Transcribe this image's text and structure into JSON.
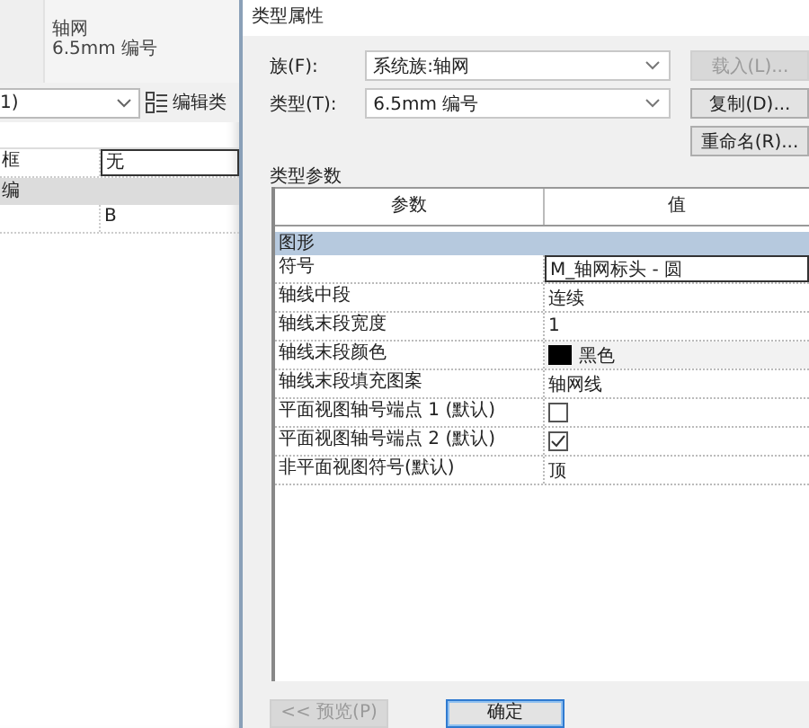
{
  "left_panel": {
    "type_name": "轴网",
    "type_value": "6.5mm 编号",
    "selector": {
      "value": "1)"
    },
    "edit_type_button": {
      "label": "编辑类"
    },
    "rows": [
      {
        "kind": "row",
        "label": "框",
        "value": "无",
        "selected": true
      },
      {
        "kind": "group",
        "label": "编"
      },
      {
        "kind": "row",
        "label": "",
        "value": "B",
        "selected": false
      }
    ]
  },
  "dialog": {
    "title": "类型属性",
    "fields": [
      {
        "label": "族(F):",
        "value": "系统族:轴网",
        "button": {
          "label": "载入(L)...",
          "disabled": true
        }
      },
      {
        "label": "类型(T):",
        "value": "6.5mm 编号",
        "button": {
          "label": "复制(D)...",
          "disabled": false
        }
      }
    ],
    "rename_button": {
      "label": "重命名(R)...",
      "disabled": false
    },
    "section_title": "类型参数",
    "table": {
      "columns": [
        "参数",
        "值"
      ],
      "group": "图形",
      "rows": [
        {
          "name": "符号",
          "kind": "text",
          "value": "M_轴网标头 - 圆",
          "selected": true
        },
        {
          "name": "轴线中段",
          "kind": "text",
          "value": "连续",
          "selected": false
        },
        {
          "name": "轴线末段宽度",
          "kind": "text",
          "value": "1",
          "selected": false
        },
        {
          "name": "轴线末段颜色",
          "kind": "color",
          "value": "黑色",
          "color": "#000000",
          "selected": false
        },
        {
          "name": "轴线末段填充图案",
          "kind": "text",
          "value": "轴网线",
          "selected": false
        },
        {
          "name": "平面视图轴号端点 1 (默认)",
          "kind": "checkbox",
          "checked": false,
          "selected": false
        },
        {
          "name": "平面视图轴号端点 2 (默认)",
          "kind": "checkbox",
          "checked": true,
          "selected": false
        },
        {
          "name": "非平面视图符号(默认)",
          "kind": "text",
          "value": "顶",
          "selected": false
        }
      ]
    },
    "footer_buttons": [
      {
        "label": "<< 预览(P)",
        "disabled": true,
        "default": false
      },
      {
        "label": "确定",
        "disabled": false,
        "default": true
      }
    ]
  }
}
